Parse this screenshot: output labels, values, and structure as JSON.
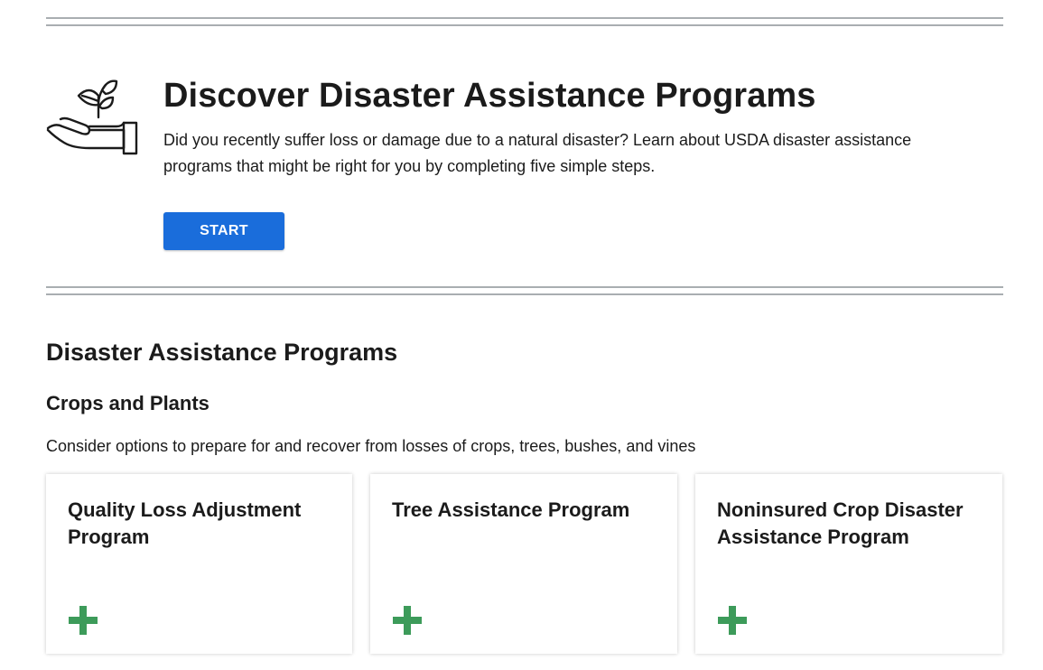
{
  "hero": {
    "icon": "plant-in-hand-icon",
    "title": "Discover Disaster Assistance Programs",
    "description": "Did you recently suffer loss or damage due to a natural disaster? Learn about USDA disaster assistance programs that might be right for you by completing five simple steps.",
    "start_label": "START"
  },
  "programs": {
    "title": "Disaster Assistance Programs",
    "category": {
      "title": "Crops and Plants",
      "description": "Consider options to prepare for and recover from losses of crops, trees, bushes, and vines",
      "cards": [
        {
          "title": "Quality Loss Adjustment Program",
          "icon": "plus-icon"
        },
        {
          "title": "Tree Assistance Program",
          "icon": "plus-icon"
        },
        {
          "title": "Noninsured Crop Disaster Assistance Program",
          "icon": "plus-icon"
        }
      ]
    }
  },
  "colors": {
    "accent": "#1a6ddb",
    "plus": "#3d9b5a",
    "rule": "#a9aeb1",
    "text": "#1b1b1b"
  }
}
